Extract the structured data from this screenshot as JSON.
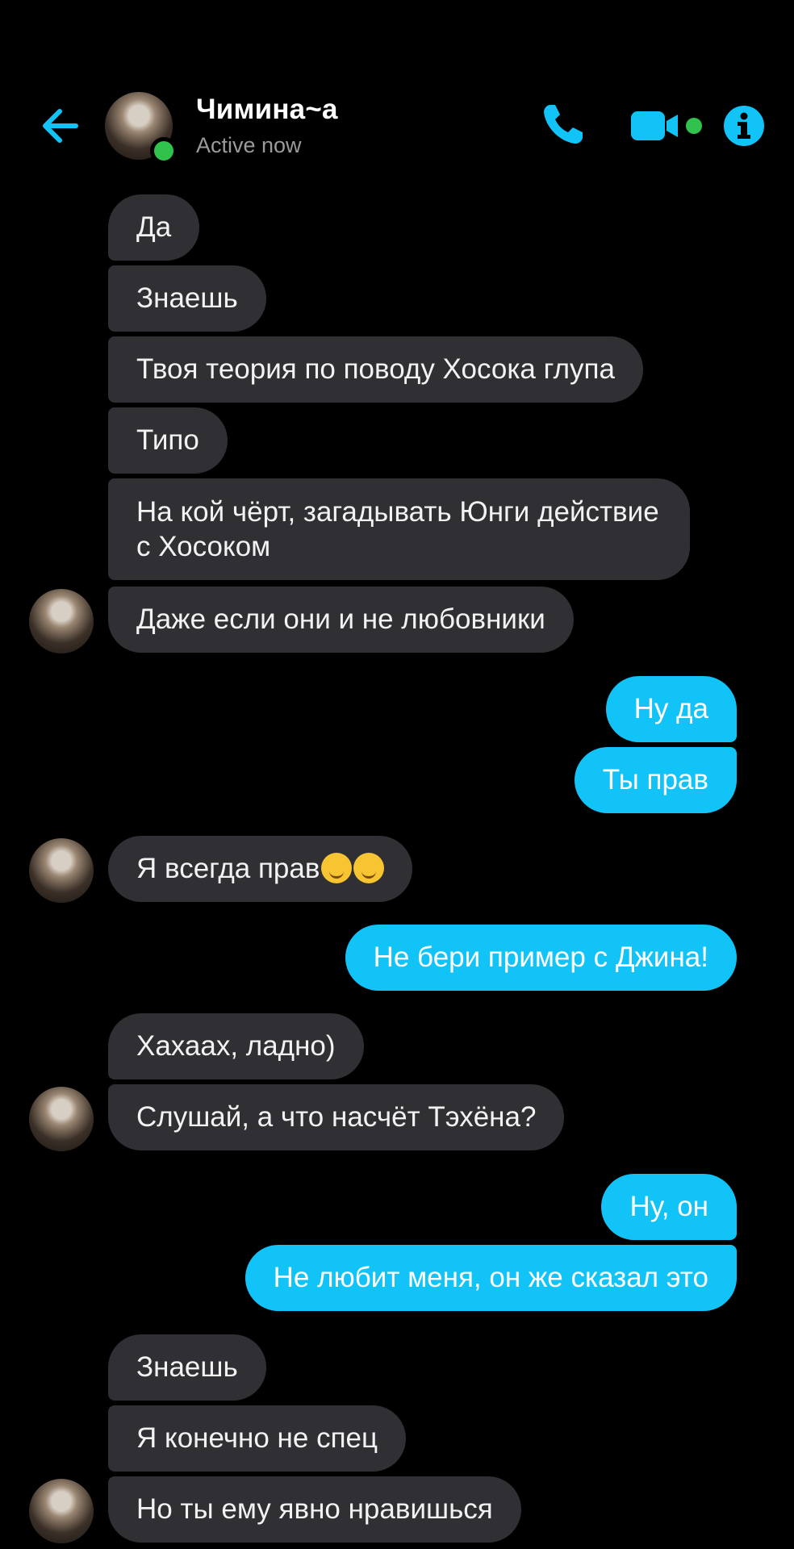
{
  "header": {
    "contact_name": "Чимина~а",
    "status": "Active now",
    "icons": {
      "back": "back-arrow-icon",
      "phone": "phone-icon",
      "video": "video-camera-icon",
      "info": "info-icon"
    },
    "accent_color": "#12c3f8",
    "online_color": "#31c24d"
  },
  "messages": [
    {
      "from": "them",
      "text": "Да"
    },
    {
      "from": "them",
      "text": "Знаешь"
    },
    {
      "from": "them",
      "text": "Твоя теория по поводу Хосока глупа"
    },
    {
      "from": "them",
      "text": "Типо"
    },
    {
      "from": "them",
      "text": "На кой чёрт, загадывать Юнги действие с Хосоком"
    },
    {
      "from": "them",
      "text": "Даже если они и не любовники"
    },
    {
      "from": "me",
      "text": "Ну да"
    },
    {
      "from": "me",
      "text": "Ты прав"
    },
    {
      "from": "them",
      "text": "Я всегда прав",
      "emojis": [
        "smirking-face-emoji",
        "tears-of-joy-emoji"
      ]
    },
    {
      "from": "me",
      "text": "Не бери пример с Джина!"
    },
    {
      "from": "them",
      "text": "Хахаах, ладно)"
    },
    {
      "from": "them",
      "text": "Слушай, а что насчёт Тэхёна?"
    },
    {
      "from": "me",
      "text": "Ну, он"
    },
    {
      "from": "me",
      "text": "Не любит меня, он же сказал это"
    },
    {
      "from": "them",
      "text": "Знаешь"
    },
    {
      "from": "them",
      "text": "Я конечно не спец"
    },
    {
      "from": "them",
      "text": "Но ты ему явно нравишься"
    }
  ],
  "colors": {
    "incoming_bubble": "#302f34",
    "outgoing_bubble": "#12c3f8",
    "background": "#000000"
  }
}
